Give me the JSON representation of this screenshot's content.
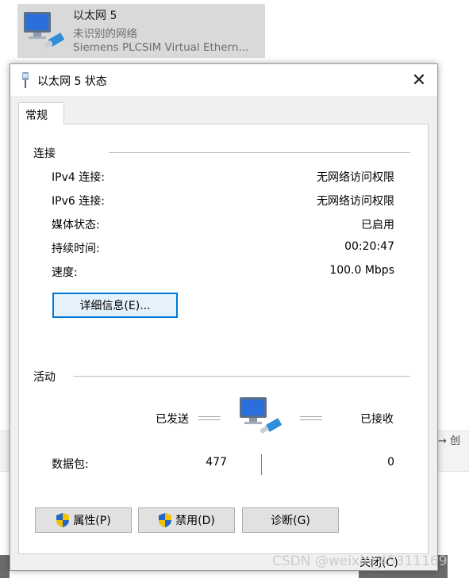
{
  "background": {
    "adapter": {
      "name": "以太网 5",
      "status": "未识别的网络",
      "device": "Siemens PLCSIM Virtual Ethern..."
    },
    "side_text": "→ 创"
  },
  "dialog": {
    "title": "以太网 5 状态",
    "close_glyph": "✕",
    "tab_label": "常规",
    "connection": {
      "section_title": "连接",
      "rows": [
        {
          "label": "IPv4 连接:",
          "value": "无网络访问权限"
        },
        {
          "label": "IPv6 连接:",
          "value": "无网络访问权限"
        },
        {
          "label": "媒体状态:",
          "value": "已启用"
        },
        {
          "label": "持续时间:",
          "value": "00:20:47"
        },
        {
          "label": "速度:",
          "value": "100.0 Mbps"
        }
      ],
      "details_button": "详细信息(E)..."
    },
    "activity": {
      "section_title": "活动",
      "sent_label": "已发送",
      "received_label": "已接收",
      "packets_label": "数据包:",
      "packets_sent": "477",
      "packets_received": "0"
    },
    "buttons": {
      "properties": "属性(P)",
      "disable": "禁用(D)",
      "diagnose": "诊断(G)"
    },
    "close_label": "关闭(C)"
  },
  "watermark": "CSDN @weixin_45311169",
  "colors": {
    "accent": "#0078d7",
    "dialog_bg": "#f0f0f0",
    "panel_bg": "#ffffff",
    "button_bg": "#e1e1e1"
  }
}
